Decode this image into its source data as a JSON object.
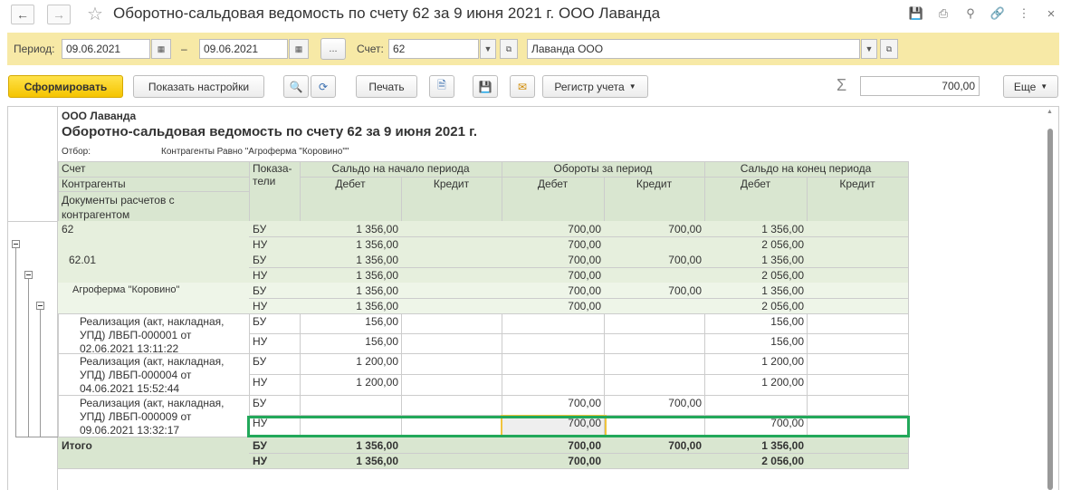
{
  "window": {
    "title": "Оборотно-сальдовая ведомость по счету 62 за 9 июня 2021 г. ООО Лаванда"
  },
  "params": {
    "period_label": "Период:",
    "date_from": "09.06.2021",
    "dash": "–",
    "date_to": "09.06.2021",
    "ellipsis": "...",
    "account_label": "Счет:",
    "account": "62",
    "org": "Лаванда ООО"
  },
  "toolbar": {
    "generate": "Сформировать",
    "show_settings": "Показать настройки",
    "print": "Печать",
    "ledger": "Регистр учета",
    "sum_value": "700,00",
    "more": "Еще"
  },
  "report": {
    "org": "ООО Лаванда",
    "title": "Оборотно-сальдовая ведомость по счету 62 за 9 июня 2021 г.",
    "filter_label": "Отбор:",
    "filter_value": "Контрагенты Равно \"Агроферма \"Коровино\"\"",
    "headers": {
      "account": "Счет",
      "counterparty": "Контрагенты",
      "docs": "Документы расчетов с контрагентом",
      "indicators": "Показа-тели",
      "opening": "Сальдо на начало периода",
      "turnover": "Обороты за период",
      "closing": "Сальдо на конец периода",
      "debit": "Дебет",
      "credit": "Кредит"
    },
    "rows": [
      {
        "label": "62",
        "ind": [
          "БУ",
          "НУ"
        ],
        "vals": [
          [
            "1 356,00",
            "",
            "700,00",
            "700,00",
            "1 356,00",
            ""
          ],
          [
            "1 356,00",
            "",
            "700,00",
            "",
            "2 056,00",
            ""
          ]
        ]
      },
      {
        "label": "62.01",
        "ind": [
          "БУ",
          "НУ"
        ],
        "vals": [
          [
            "1 356,00",
            "",
            "700,00",
            "700,00",
            "1 356,00",
            ""
          ],
          [
            "1 356,00",
            "",
            "700,00",
            "",
            "2 056,00",
            ""
          ]
        ]
      },
      {
        "label": "Агроферма \"Коровино\"",
        "ind": [
          "БУ",
          "НУ"
        ],
        "vals": [
          [
            "1 356,00",
            "",
            "700,00",
            "700,00",
            "1 356,00",
            ""
          ],
          [
            "1 356,00",
            "",
            "700,00",
            "",
            "2 056,00",
            ""
          ]
        ]
      },
      {
        "label": "Реализация (акт, накладная, УПД) ЛВБП-000001 от 02.06.2021 13:11:22",
        "ind": [
          "БУ",
          "НУ"
        ],
        "vals": [
          [
            "156,00",
            "",
            "",
            "",
            "156,00",
            ""
          ],
          [
            "156,00",
            "",
            "",
            "",
            "156,00",
            ""
          ]
        ]
      },
      {
        "label": "Реализация (акт, накладная, УПД) ЛВБП-000004 от 04.06.2021 15:52:44",
        "ind": [
          "БУ",
          "НУ"
        ],
        "vals": [
          [
            "1 200,00",
            "",
            "",
            "",
            "1 200,00",
            ""
          ],
          [
            "1 200,00",
            "",
            "",
            "",
            "1 200,00",
            ""
          ]
        ]
      },
      {
        "label": "Реализация (акт, накладная, УПД) ЛВБП-000009 от 09.06.2021 13:32:17",
        "ind": [
          "БУ",
          "НУ"
        ],
        "vals": [
          [
            "",
            "",
            "700,00",
            "700,00",
            "",
            ""
          ],
          [
            "",
            "",
            "700,00",
            "",
            "700,00",
            ""
          ]
        ]
      }
    ],
    "total": {
      "label": "Итого",
      "ind": [
        "БУ",
        "НУ"
      ],
      "vals": [
        [
          "1 356,00",
          "",
          "700,00",
          "700,00",
          "1 356,00",
          ""
        ],
        [
          "1 356,00",
          "",
          "700,00",
          "",
          "2 056,00",
          ""
        ]
      ]
    }
  },
  "colors": {
    "accent_yellow": "#f5c400",
    "highlight_green": "#22a85a",
    "header_green": "#d9e6d0"
  }
}
